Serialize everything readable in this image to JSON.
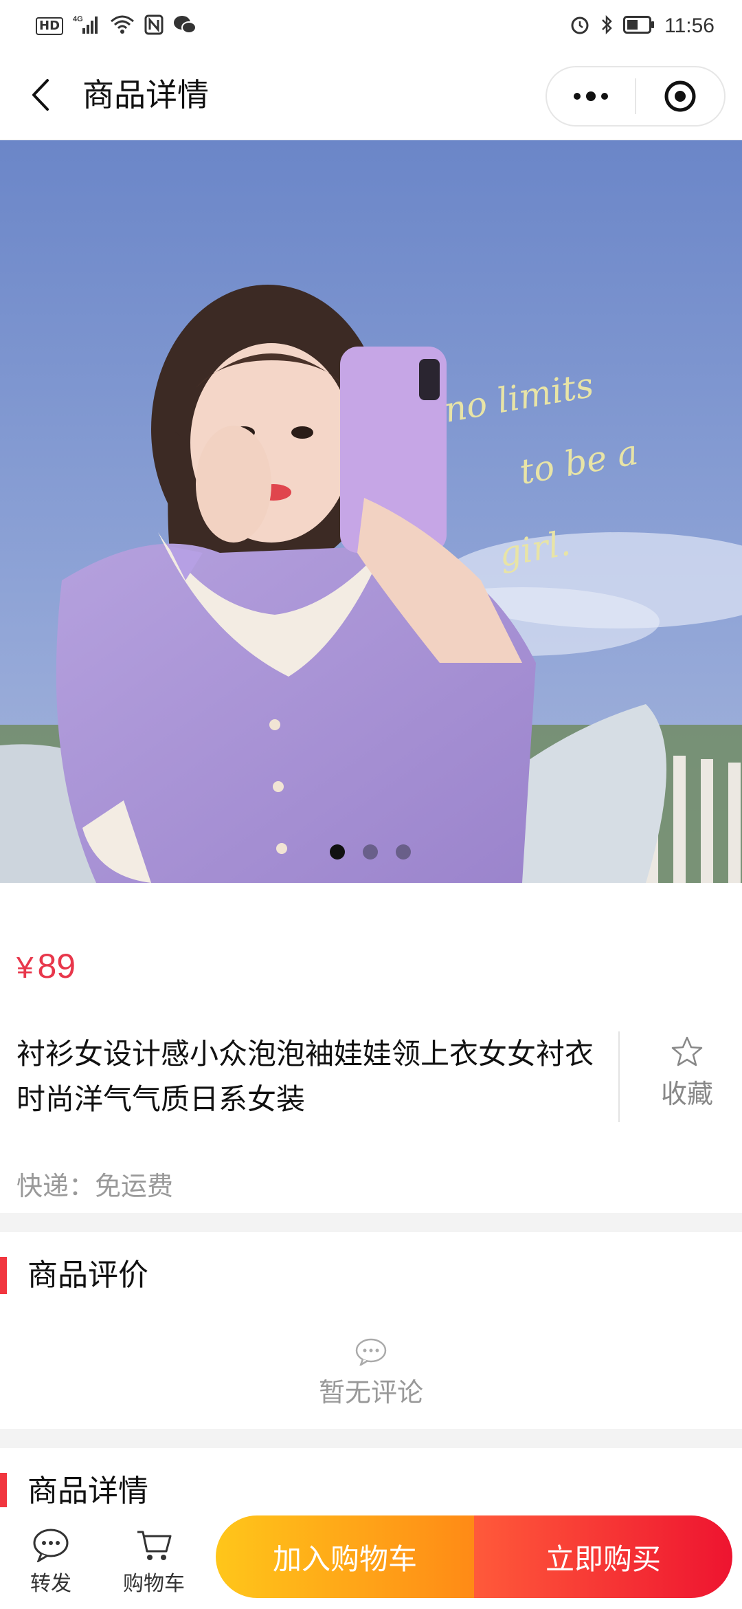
{
  "status_bar": {
    "network_badge": "HD",
    "network_type": "4G",
    "time": "11:56",
    "icons": [
      "hd-icon",
      "signal-icon",
      "wifi-icon",
      "nfc-icon",
      "wechat-icon",
      "alarm-icon",
      "bluetooth-icon",
      "battery-icon"
    ]
  },
  "nav": {
    "title": "商品详情",
    "back_icon": "chevron-left-icon",
    "more_icon": "more-dots-icon",
    "close_icon": "target-icon"
  },
  "banner": {
    "image_text": [
      "no limits",
      "to be a",
      "girl."
    ],
    "slide_count": 3,
    "active_slide": 1
  },
  "product": {
    "price_symbol": "¥",
    "price": "89",
    "title": "衬衫女设计感小众泡泡袖娃娃领上衣女女衬衣时尚洋气气质日系女装",
    "favorite_label": "收藏",
    "shipping": "快递：免运费"
  },
  "reviews": {
    "heading": "商品评价",
    "empty_text": "暂无评论"
  },
  "details": {
    "heading": "商品详情"
  },
  "bottom_bar": {
    "share_label": "转发",
    "cart_label": "购物车",
    "add_to_cart": "加入购物车",
    "buy_now": "立即购买"
  },
  "colors": {
    "price_red": "#e8374b",
    "accent_bar": "#f1363f",
    "cart_gradient_start": "#ffc61a",
    "cart_gradient_end": "#ff8a16",
    "buy_gradient_start": "#ff5a3a",
    "buy_gradient_end": "#ee1430"
  }
}
